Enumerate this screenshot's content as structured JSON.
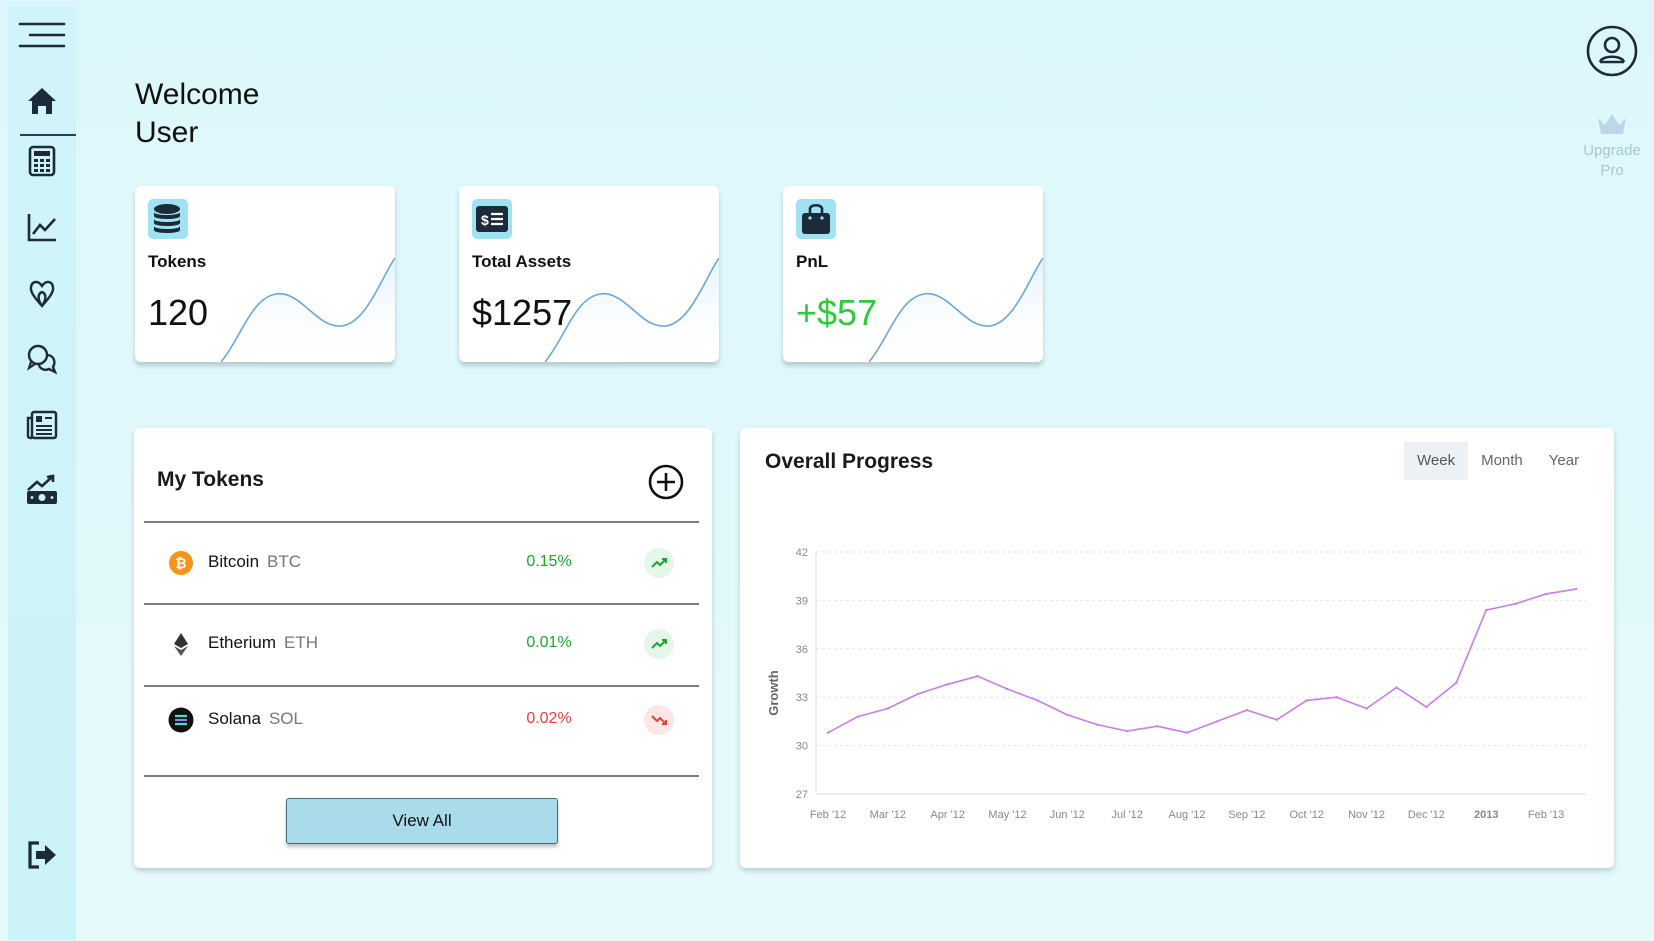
{
  "sidebar": {
    "icons": [
      "menu-icon",
      "home-icon",
      "calculator-icon",
      "chart-line-icon",
      "airbnb-icon",
      "chat-icon",
      "news-icon",
      "money-growth-icon",
      "logout-icon"
    ]
  },
  "welcome": {
    "line1": "Welcome",
    "line2": "User"
  },
  "upgrade": {
    "line1": "Upgrade",
    "line2": "Pro"
  },
  "stats": {
    "tokens": {
      "label": "Tokens",
      "value": "120"
    },
    "assets": {
      "label": "Total Assets",
      "value": "$1257"
    },
    "pnl": {
      "label": "PnL",
      "value": "+$57"
    }
  },
  "my_tokens": {
    "title": "My Tokens",
    "rows": [
      {
        "name": "Bitcoin",
        "symbol": "BTC",
        "change": "0.15%",
        "direction": "up"
      },
      {
        "name": "Etherium",
        "symbol": "ETH",
        "change": "0.01%",
        "direction": "up"
      },
      {
        "name": "Solana",
        "symbol": "SOL",
        "change": "0.02%",
        "direction": "down"
      }
    ],
    "view_all": "View All"
  },
  "progress": {
    "title": "Overall Progress",
    "tabs": [
      "Week",
      "Month",
      "Year"
    ],
    "active_tab": "Week"
  },
  "colors": {
    "accent": "#9fe3f2",
    "line": "#c77ee6",
    "up": "#19a82e",
    "down": "#e2413f",
    "pnl": "#2bcc3a"
  },
  "chart_data": {
    "type": "line",
    "ylabel": "Growth",
    "ylim": [
      27,
      42
    ],
    "yticks": [
      42,
      39,
      36,
      33,
      30,
      27
    ],
    "xticks": [
      "Feb '12",
      "Mar '12",
      "Apr '12",
      "May '12",
      "Jun '12",
      "Jul '12",
      "Aug '12",
      "Sep '12",
      "Oct '12",
      "Nov '12",
      "Dec '12",
      "2013",
      "Feb '13"
    ],
    "x": [
      0,
      0.5,
      1,
      1.5,
      2,
      2.5,
      3,
      3.5,
      4,
      4.5,
      5,
      5.5,
      6,
      6.5,
      7,
      7.5,
      8,
      8.5,
      9,
      9.5,
      10,
      10.5,
      11,
      11.5,
      12,
      12.5
    ],
    "values": [
      30.8,
      31.8,
      32.3,
      33.2,
      33.8,
      34.3,
      33.5,
      32.8,
      31.9,
      31.3,
      30.9,
      31.2,
      30.8,
      31.5,
      32.2,
      31.6,
      32.8,
      33.0,
      32.3,
      33.6,
      32.4,
      33.9,
      38.4,
      38.8,
      39.4,
      39.7
    ],
    "grid": true
  }
}
